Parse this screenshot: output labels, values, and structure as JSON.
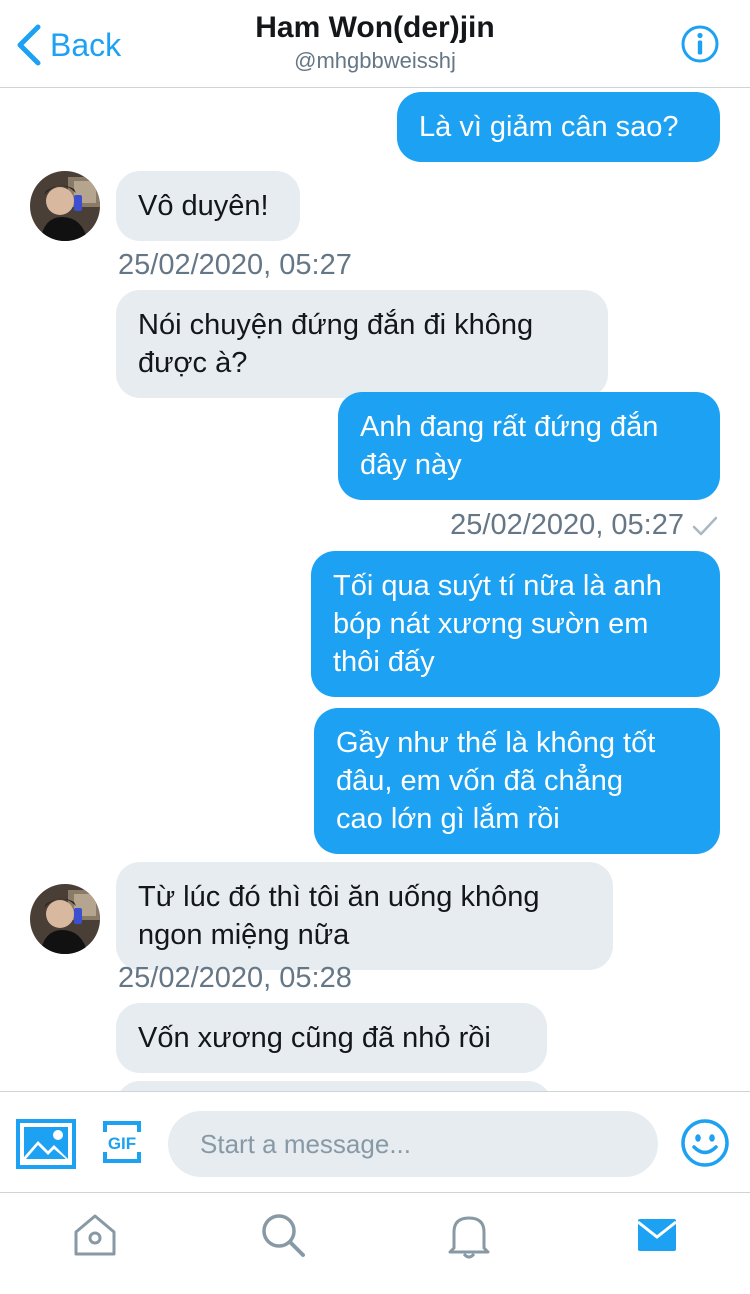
{
  "header": {
    "back_label": "Back",
    "title": "Ham Won(der)jin",
    "handle": "@mhgbbweisshj"
  },
  "colors": {
    "accent": "#1da1f2",
    "incoming_bubble": "#e6ecf0",
    "secondary_text": "#657786"
  },
  "messages": [
    {
      "direction": "out",
      "text": "Là vì giảm cân sao?"
    },
    {
      "direction": "in",
      "text": "Vô duyên!"
    },
    {
      "direction": "in",
      "text": "Nói chuyện đứng đắn đi không\nđược à?"
    },
    {
      "direction": "out",
      "text": "Anh đang rất đứng đắn\nđây này"
    },
    {
      "direction": "out",
      "text": "Tối qua suýt tí nữa là anh\nbóp nát xương sườn em\nthôi đấy"
    },
    {
      "direction": "out",
      "text": "Gầy như thế là không tốt\nđâu, em vốn đã chẳng\ncao lớn gì lắm rồi"
    },
    {
      "direction": "in",
      "text": "Từ lúc đó thì tôi ăn uống không\nngon miệng nữa"
    },
    {
      "direction": "in",
      "text": "Vốn xương cũng đã nhỏ rồi"
    }
  ],
  "timestamps": [
    "25/02/2020, 05:27",
    "25/02/2020, 05:27",
    "25/02/2020, 05:28"
  ],
  "composer": {
    "placeholder": "Start a message...",
    "gif_label": "GIF"
  },
  "icons": {
    "back": "chevron-left-icon",
    "info": "info-icon",
    "media": "image-icon",
    "gif": "gif-icon",
    "emoji": "emoji-icon",
    "home": "home-icon",
    "search": "search-icon",
    "notifications": "bell-icon",
    "messages": "mail-icon"
  },
  "tabs": {
    "active": "messages"
  }
}
